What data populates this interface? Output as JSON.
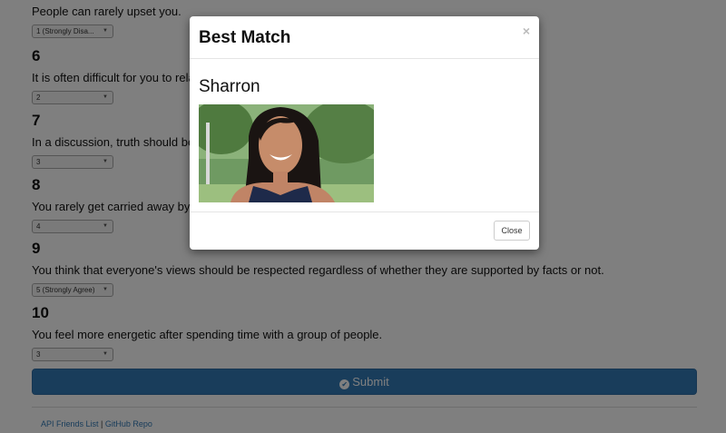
{
  "questions": [
    {
      "number": "",
      "text": "People can rarely upset you.",
      "value": "1 (Strongly Disa..."
    },
    {
      "number": "6",
      "text": "It is often difficult for you to relat",
      "value": "2"
    },
    {
      "number": "7",
      "text": "In a discussion, truth should be r",
      "value": "3"
    },
    {
      "number": "8",
      "text": "You rarely get carried away by fa",
      "value": "4"
    },
    {
      "number": "9",
      "text": "You think that everyone's views should be respected regardless of whether they are supported by facts or not.",
      "value": "5 (Strongly Agree)"
    },
    {
      "number": "10",
      "text": "You feel more energetic after spending time with a group of people.",
      "value": "3"
    }
  ],
  "submit_label": "Submit",
  "footer": {
    "link1": "API Friends List",
    "separator": " | ",
    "link2": "GitHub Repo"
  },
  "modal": {
    "title": "Best Match",
    "close_x": "×",
    "match_name": "Sharron",
    "close_button": "Close"
  },
  "colors": {
    "primary": "#337ab7",
    "backdrop": "rgba(0,0,0,0.5)"
  },
  "icons": {
    "submit": "check-circle-icon",
    "dropdown": "caret-down-icon",
    "dismiss": "close-icon"
  }
}
